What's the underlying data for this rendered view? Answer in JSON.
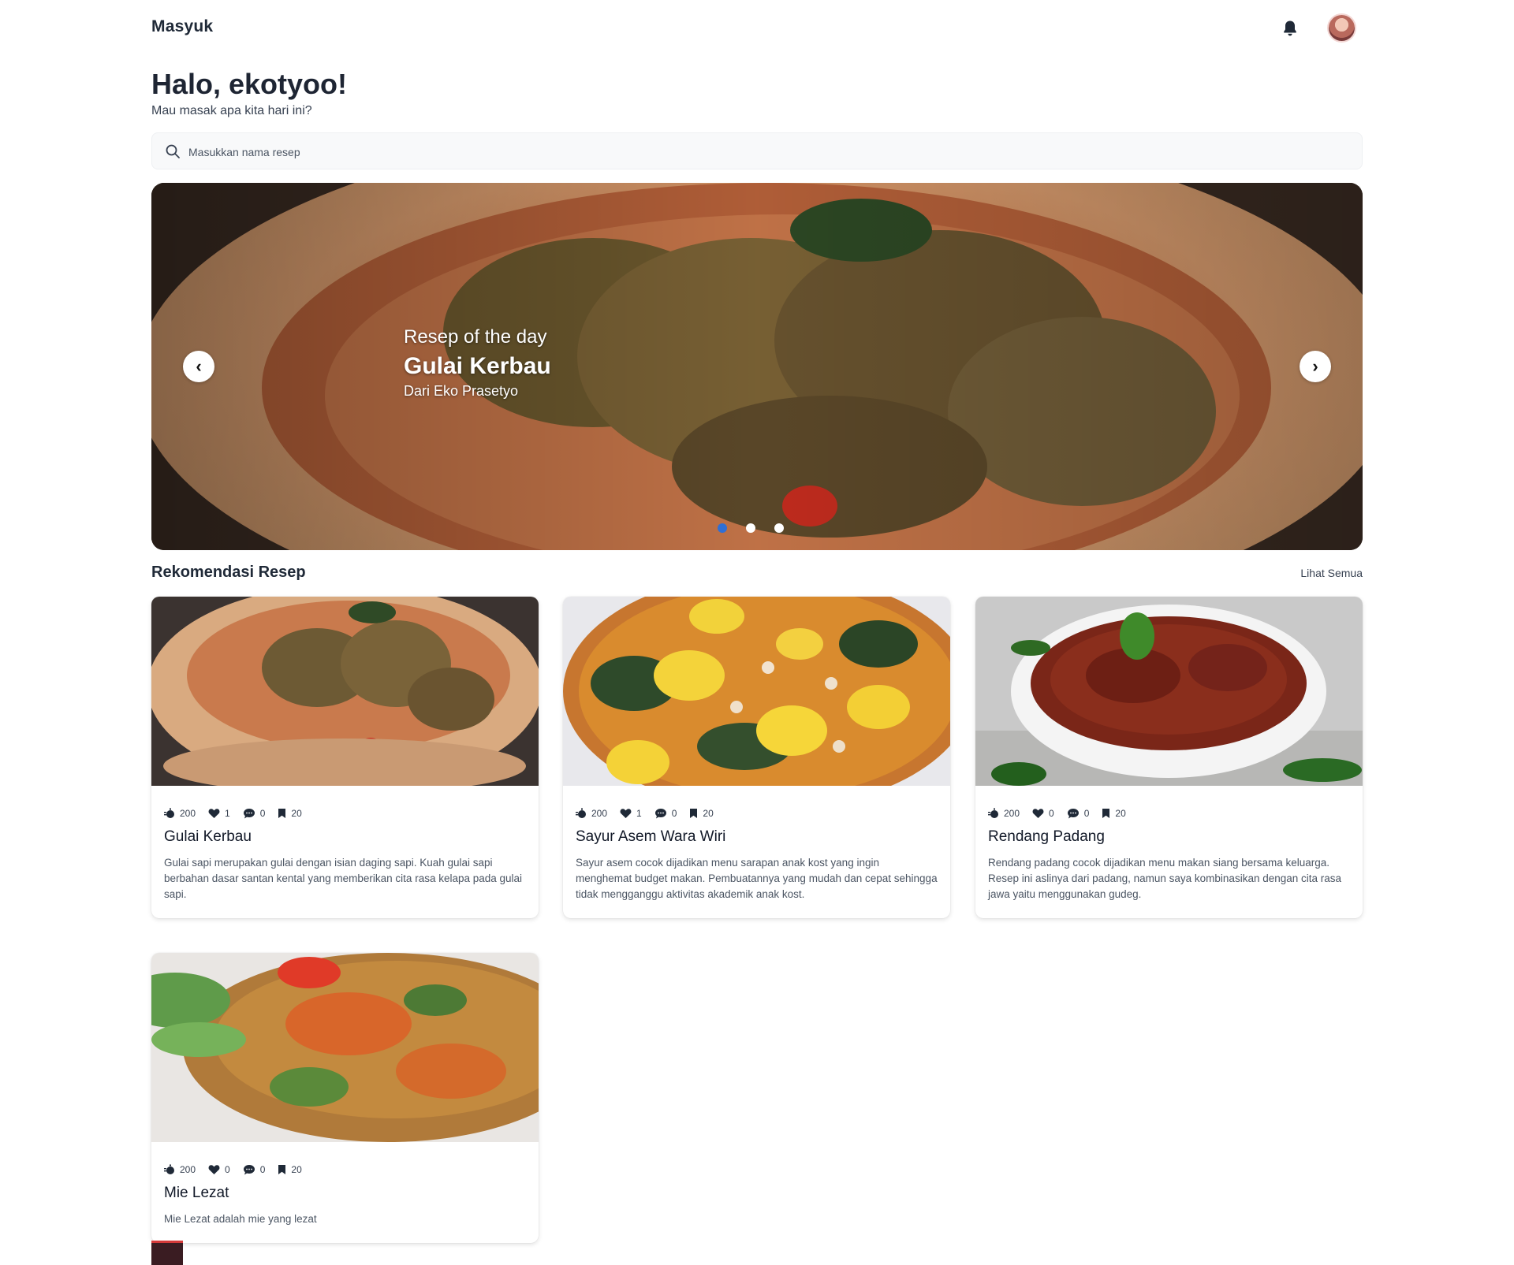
{
  "app": {
    "brand": "Masyuk"
  },
  "header": {
    "notification_icon": "bell-icon",
    "avatar_icon": "user-avatar"
  },
  "greeting": {
    "title": "Halo, ekotyoo!",
    "subtitle": "Mau masak apa kita hari ini?"
  },
  "search": {
    "placeholder": "Masukkan nama resep",
    "icon": "search-icon"
  },
  "hero": {
    "kicker": "Resep of the day",
    "title": "Gulai Kerbau",
    "author": "Dari Eko Prasetyo",
    "prev_label": "‹",
    "next_label": "›",
    "slides": 3,
    "active_slide": 1
  },
  "section": {
    "title": "Rekomendasi Resep",
    "see_all": "Lihat Semua"
  },
  "recipes": [
    {
      "title": "Gulai Kerbau",
      "views": "200",
      "likes": "1",
      "comments": "0",
      "bookmarks": "20",
      "desc": "Gulai sapi merupakan gulai dengan isian daging sapi. Kuah gulai sapi berbahan dasar santan kental yang memberikan cita rasa kelapa pada gulai sapi."
    },
    {
      "title": "Sayur Asem Wara Wiri",
      "views": "200",
      "likes": "1",
      "comments": "0",
      "bookmarks": "20",
      "desc": "Sayur asem cocok dijadikan menu sarapan anak kost yang ingin menghemat budget makan. Pembuatannya yang mudah dan cepat sehingga tidak mengganggu aktivitas akademik anak kost."
    },
    {
      "title": "Rendang Padang",
      "views": "200",
      "likes": "0",
      "comments": "0",
      "bookmarks": "20",
      "desc": "Rendang padang cocok dijadikan menu makan siang bersama keluarga. Resep ini aslinya dari padang, namun saya kombinasikan dengan cita rasa jawa yaitu menggunakan gudeg."
    },
    {
      "title": "Mie Lezat",
      "views": "200",
      "likes": "0",
      "comments": "0",
      "bookmarks": "20",
      "desc": "Mie Lezat adalah mie yang lezat"
    }
  ],
  "colors": {
    "accent": "#2f6fd6",
    "text": "#1f2937",
    "search_bg": "#f8f9fa"
  }
}
